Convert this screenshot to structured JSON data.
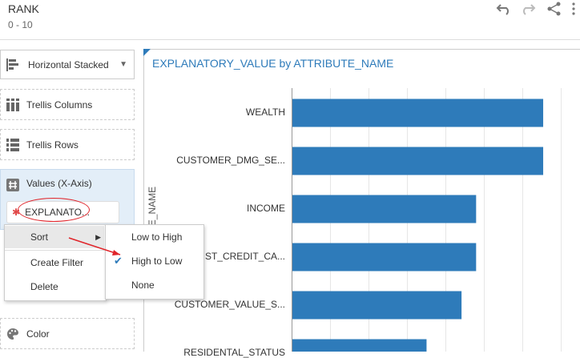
{
  "header": {
    "title": "RANK",
    "subtitle": "0 - 10"
  },
  "toolbar": {
    "icons": [
      "undo-icon",
      "redo-icon",
      "share-icon",
      "more-icon"
    ]
  },
  "sidebar": {
    "chart_type": "Horizontal Stacked",
    "wells": [
      {
        "label": "Trellis Columns"
      },
      {
        "label": "Trellis Rows"
      },
      {
        "label": "Values (X-Axis)"
      },
      {
        "label": "Color"
      }
    ],
    "value_pill": "EXPLANATO..."
  },
  "context_menu": {
    "items": [
      "Sort",
      "Create Filter",
      "Delete"
    ]
  },
  "sort_submenu": {
    "items": [
      "Low to High",
      "High to Low",
      "None"
    ],
    "selected": "High to Low"
  },
  "chart_data": {
    "type": "bar",
    "title": "EXPLANATORY_VALUE by ATTRIBUTE_NAME",
    "ylabel": "ATTRIBUTE_NAME",
    "categories": [
      "WEALTH",
      "CUSTOMER_DMG_SE...",
      "INCOME",
      "...ST_CREDIT_CA...",
      "CUSTOMER_VALUE_S...",
      "RESIDENTAL_STATUS"
    ],
    "values": [
      0.86,
      0.86,
      0.63,
      0.63,
      0.58,
      0.46
    ],
    "xlim": [
      0,
      1.0
    ],
    "bar_color": "#2e7bba",
    "grid": true
  }
}
